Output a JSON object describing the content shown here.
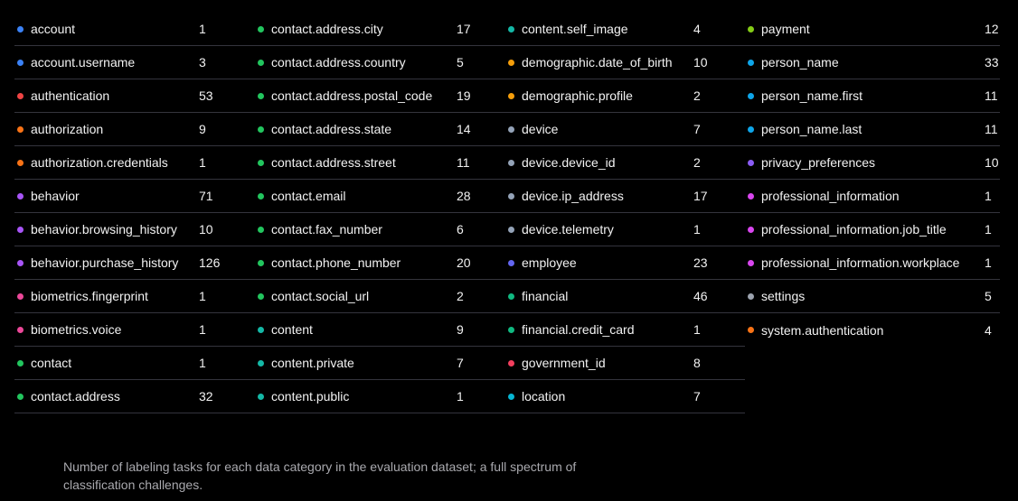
{
  "columns": [
    [
      {
        "label": "account",
        "count": "1",
        "color": "#3b82f6"
      },
      {
        "label": "account.username",
        "count": "3",
        "color": "#3b82f6"
      },
      {
        "label": "authentication",
        "count": "53",
        "color": "#ef4444"
      },
      {
        "label": "authorization",
        "count": "9",
        "color": "#f97316"
      },
      {
        "label": "authorization.credentials",
        "count": "1",
        "color": "#f97316"
      },
      {
        "label": "behavior",
        "count": "71",
        "color": "#a855f7"
      },
      {
        "label": "behavior.browsing_history",
        "count": "10",
        "color": "#a855f7"
      },
      {
        "label": "behavior.purchase_history",
        "count": "126",
        "color": "#a855f7"
      },
      {
        "label": "biometrics.fingerprint",
        "count": "1",
        "color": "#ec4899"
      },
      {
        "label": "biometrics.voice",
        "count": "1",
        "color": "#ec4899"
      },
      {
        "label": "contact",
        "count": "1",
        "color": "#22c55e"
      },
      {
        "label": "contact.address",
        "count": "32",
        "color": "#22c55e"
      }
    ],
    [
      {
        "label": "contact.address.city",
        "count": "17",
        "color": "#22c55e"
      },
      {
        "label": "contact.address.country",
        "count": "5",
        "color": "#22c55e"
      },
      {
        "label": "contact.address.postal_code",
        "count": "19",
        "color": "#22c55e"
      },
      {
        "label": "contact.address.state",
        "count": "14",
        "color": "#22c55e"
      },
      {
        "label": "contact.address.street",
        "count": "11",
        "color": "#22c55e"
      },
      {
        "label": "contact.email",
        "count": "28",
        "color": "#22c55e"
      },
      {
        "label": "contact.fax_number",
        "count": "6",
        "color": "#22c55e"
      },
      {
        "label": "contact.phone_number",
        "count": "20",
        "color": "#22c55e"
      },
      {
        "label": "contact.social_url",
        "count": "2",
        "color": "#22c55e"
      },
      {
        "label": "content",
        "count": "9",
        "color": "#14b8a6"
      },
      {
        "label": "content.private",
        "count": "7",
        "color": "#14b8a6"
      },
      {
        "label": "content.public",
        "count": "1",
        "color": "#14b8a6"
      }
    ],
    [
      {
        "label": "content.self_image",
        "count": "4",
        "color": "#14b8a6"
      },
      {
        "label": "demographic.date_of_birth",
        "count": "10",
        "color": "#f59e0b"
      },
      {
        "label": "demographic.profile",
        "count": "2",
        "color": "#f59e0b"
      },
      {
        "label": "device",
        "count": "7",
        "color": "#94a3b8"
      },
      {
        "label": "device.device_id",
        "count": "2",
        "color": "#94a3b8"
      },
      {
        "label": "device.ip_address",
        "count": "17",
        "color": "#94a3b8"
      },
      {
        "label": "device.telemetry",
        "count": "1",
        "color": "#94a3b8"
      },
      {
        "label": "employee",
        "count": "23",
        "color": "#6366f1"
      },
      {
        "label": "financial",
        "count": "46",
        "color": "#10b981"
      },
      {
        "label": "financial.credit_card",
        "count": "1",
        "color": "#10b981"
      },
      {
        "label": "government_id",
        "count": "8",
        "color": "#f43f5e"
      },
      {
        "label": "location",
        "count": "7",
        "color": "#06b6d4"
      }
    ],
    [
      {
        "label": "payment",
        "count": "12",
        "color": "#84cc16"
      },
      {
        "label": "person_name",
        "count": "33",
        "color": "#0ea5e9"
      },
      {
        "label": "person_name.first",
        "count": "11",
        "color": "#0ea5e9"
      },
      {
        "label": "person_name.last",
        "count": "11",
        "color": "#0ea5e9"
      },
      {
        "label": "privacy_preferences",
        "count": "10",
        "color": "#8b5cf6"
      },
      {
        "label": "professional_information",
        "count": "1",
        "color": "#d946ef"
      },
      {
        "label": "professional_information.job_title",
        "count": "1",
        "color": "#d946ef"
      },
      {
        "label": "professional_information.workplace",
        "count": "1",
        "color": "#d946ef"
      },
      {
        "label": "settings",
        "count": "5",
        "color": "#9ca3af"
      },
      {
        "label": "system.authentication",
        "count": "4",
        "color": "#f97316"
      }
    ]
  ],
  "caption": "Number of labeling tasks for each data category in the evaluation dataset; a full spectrum of classification challenges."
}
